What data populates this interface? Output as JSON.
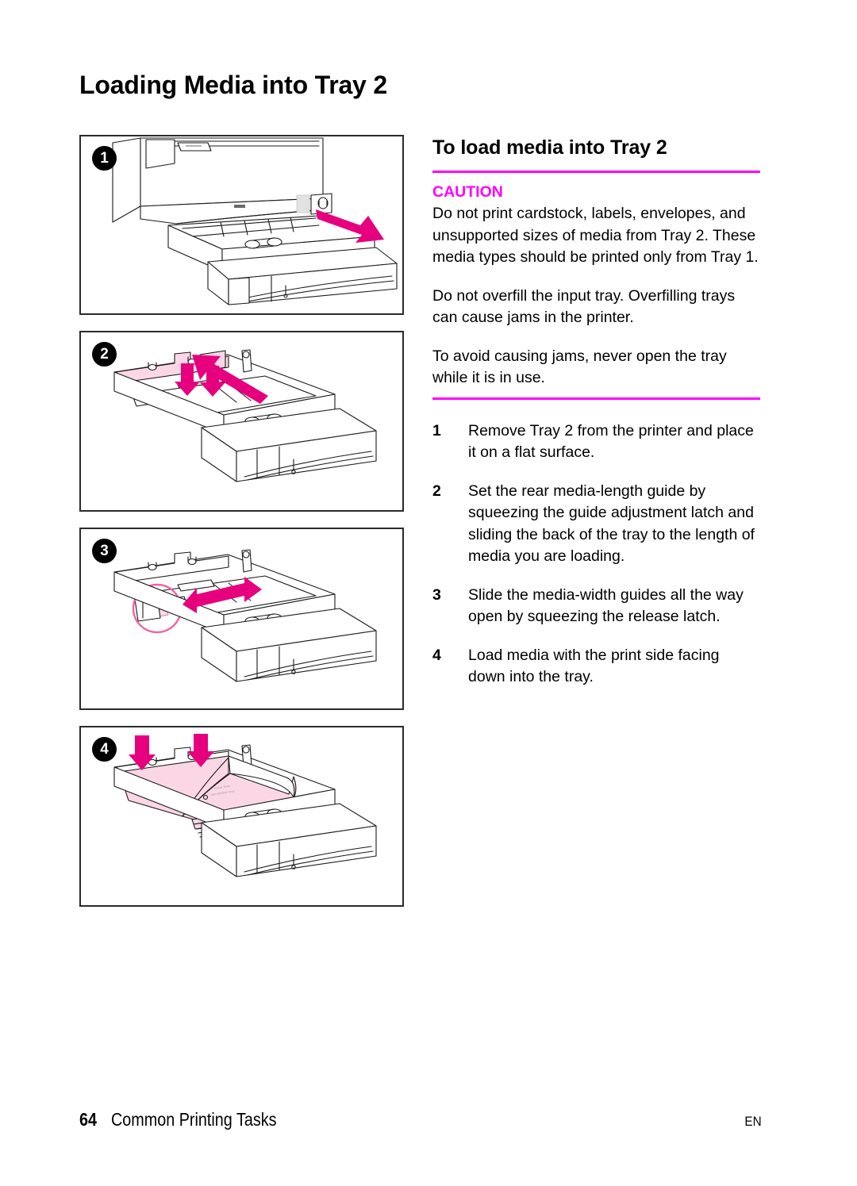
{
  "document": {
    "title": "Loading Media into Tray 2"
  },
  "figures": {
    "panels": [
      {
        "badge": "1",
        "name": "printer-tray-removal-illustration",
        "alt": "Printer with Tray 2 being pulled out, magenta arrow pointing out and down"
      },
      {
        "badge": "2",
        "name": "rear-media-length-guide-illustration",
        "alt": "Tray 2 with rear media-length guide highlighted and arrows showing squeeze and slide"
      },
      {
        "badge": "3",
        "name": "media-width-guides-illustration",
        "alt": "Tray 2 with double-headed arrow showing media-width guides sliding open, release latch circled"
      },
      {
        "badge": "4",
        "name": "load-media-illustration",
        "alt": "Tray 2 with stack of media being loaded print side down, two arrows pointing down"
      }
    ]
  },
  "content": {
    "section_heading": "To load media into Tray 2",
    "caution_label": "CAUTION",
    "caution_paragraphs": [
      "Do not print cardstock, labels, envelopes, and unsupported sizes of media from Tray 2. These media types should be printed only from Tray 1.",
      "Do not overfill the input tray. Overfilling trays can cause jams in the printer.",
      "To avoid causing jams, never open the tray while it is in use."
    ],
    "steps": [
      {
        "number": "1",
        "text": "Remove Tray 2 from the printer and place it on a flat surface."
      },
      {
        "number": "2",
        "text": "Set the rear media-length guide by squeezing the guide adjustment latch and sliding the back of the tray to the length of media you are loading."
      },
      {
        "number": "3",
        "text": "Slide the media-width guides all the way open by squeezing the release latch."
      },
      {
        "number": "4",
        "text": "Load media with the print side facing down into the tray."
      }
    ]
  },
  "footer": {
    "page_number": "64",
    "section_title": "Common Printing Tasks",
    "language": "EN"
  },
  "colors": {
    "accent_magenta": "#FF00FF",
    "arrow_magenta": "#E6007E",
    "highlight_pink": "#FBD7E6",
    "text": "#000000",
    "panel_border": "#2B2B2B"
  }
}
